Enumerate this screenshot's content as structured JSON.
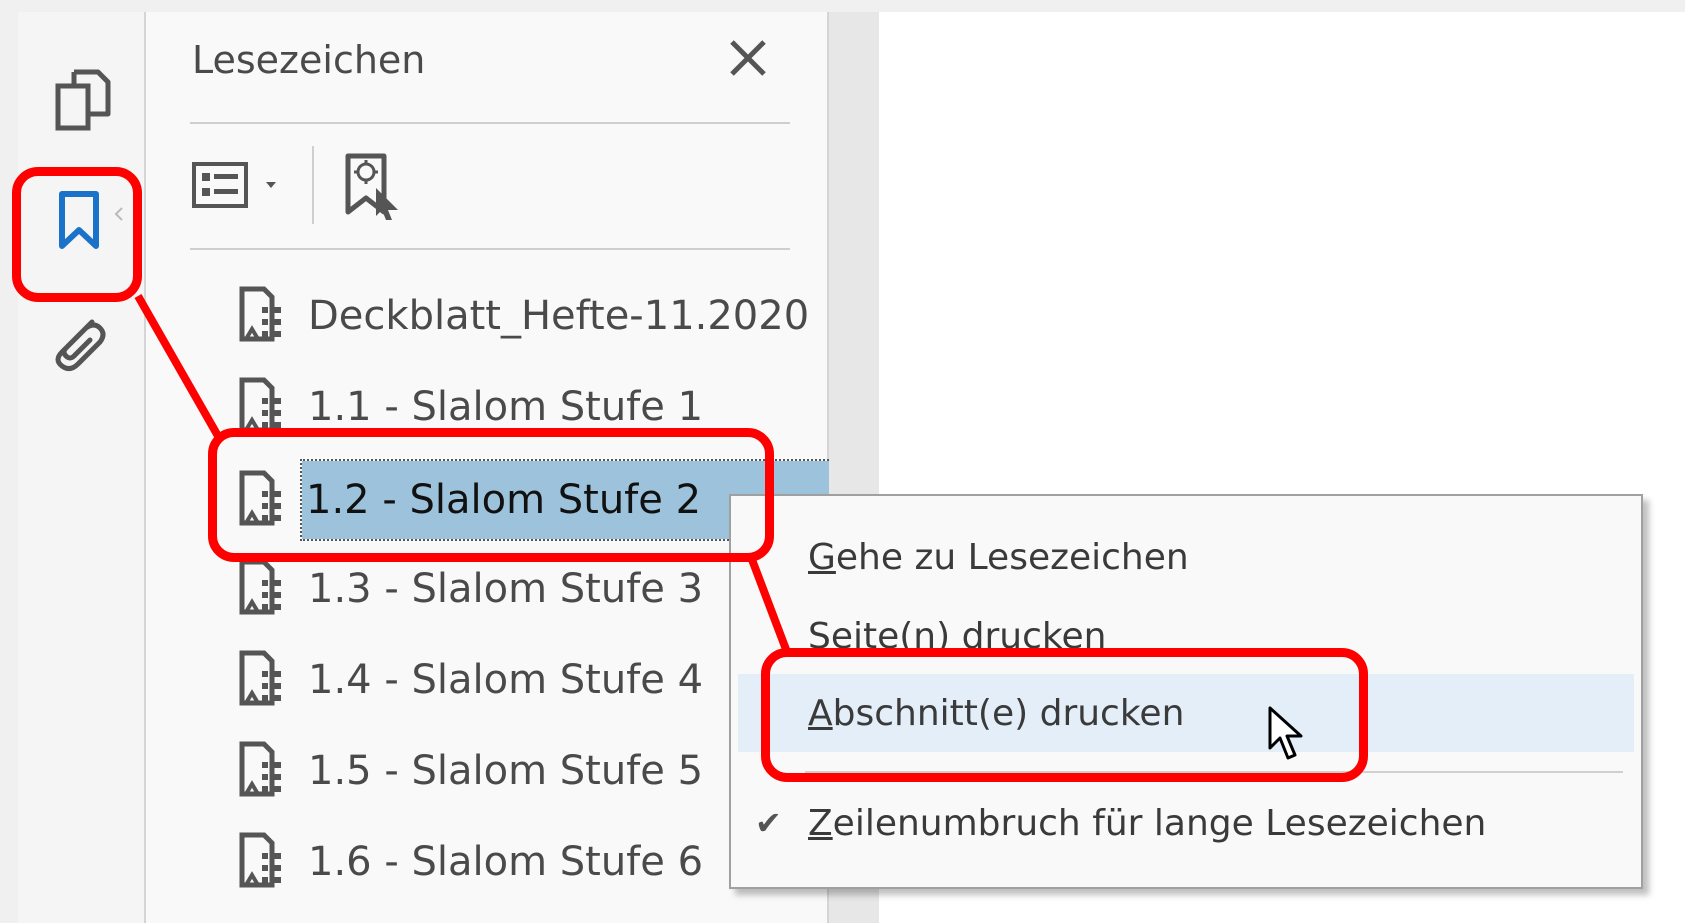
{
  "panel": {
    "title": "Lesezeichen"
  },
  "left_toolbar": {
    "items": [
      {
        "icon": "pages-icon"
      },
      {
        "icon": "bookmark-icon",
        "active": true
      },
      {
        "icon": "paperclip-icon"
      }
    ]
  },
  "bookmarks": [
    {
      "label": "Deckblatt_Hefte-11.2020"
    },
    {
      "label": "1.1 - Slalom Stufe 1"
    },
    {
      "label": "1.2 - Slalom Stufe 2",
      "selected": true
    },
    {
      "label": "1.3 - Slalom Stufe 3"
    },
    {
      "label": "1.4 - Slalom Stufe 4"
    },
    {
      "label": "1.5 - Slalom Stufe 5"
    },
    {
      "label": "1.6 - Slalom Stufe 6"
    }
  ],
  "context_menu": {
    "items": [
      {
        "label": "Gehe zu Lesezeichen",
        "accel": "G"
      },
      {
        "label": "Seite(n) drucken"
      },
      {
        "label": "Abschnitt(e) drucken",
        "accel": "A",
        "highlighted": true
      },
      {
        "label": "Zeilenumbruch für lange Lesezeichen",
        "accel": "Z",
        "checked": true
      }
    ]
  },
  "colors": {
    "highlight_red": "#ff0000",
    "selection_bg": "#9cc2dc",
    "menu_hover": "#e3eef9",
    "active_icon": "#1a73c8"
  }
}
